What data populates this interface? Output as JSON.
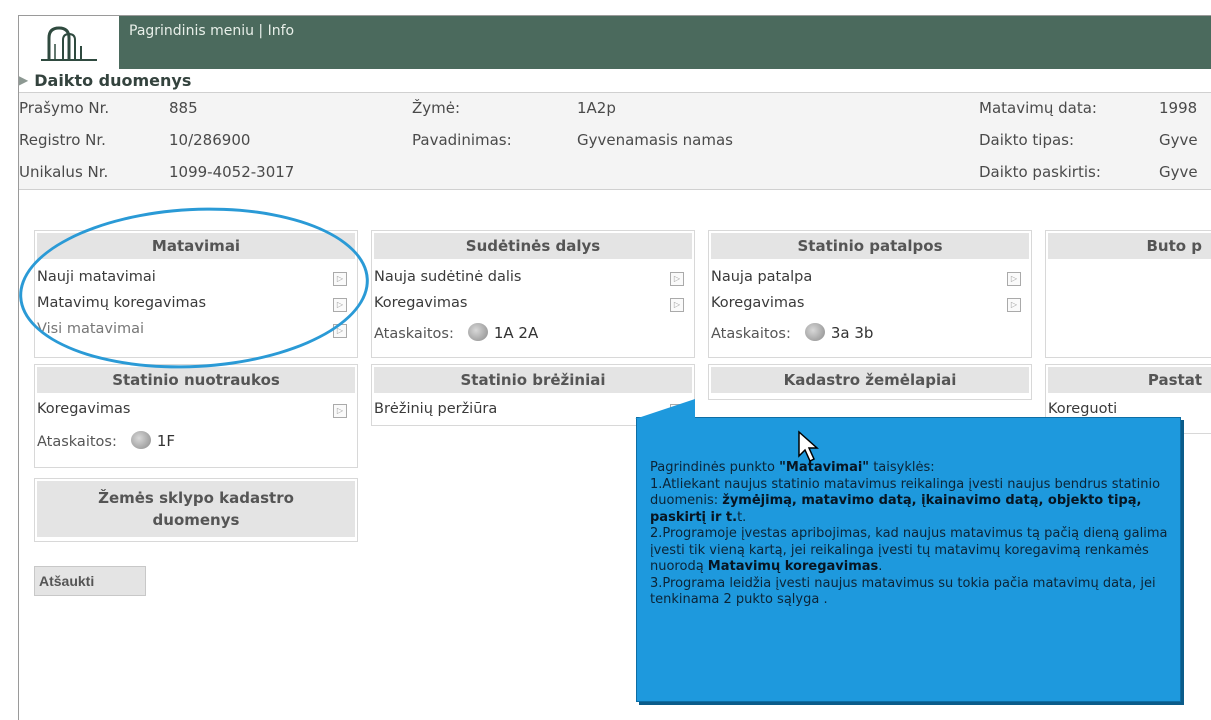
{
  "header": {
    "menu_main": "Pagrindinis meniu",
    "menu_sep": "|",
    "menu_info": "Info"
  },
  "section": {
    "title": "Daikto duomenys"
  },
  "info": {
    "request_no_label": "Prašymo Nr.",
    "request_no": "885",
    "registry_no_label": "Registro Nr.",
    "registry_no": "10/286900",
    "unique_no_label": "Unikalus Nr.",
    "unique_no": "1099-4052-3017",
    "mark_label": "Žymė:",
    "mark": "1A2p",
    "name_label": "Pavadinimas:",
    "name": "Gyvenamasis namas",
    "measure_date_label": "Matavimų data:",
    "measure_date": "1998",
    "type_label": "Daikto tipas:",
    "type": "Gyve",
    "purpose_label": "Daikto paskirtis:",
    "purpose": "Gyve"
  },
  "panels": {
    "matavimai": {
      "title": "Matavimai",
      "items": [
        "Nauji matavimai",
        "Matavimų koregavimas",
        "Visi matavimai"
      ]
    },
    "sudetines": {
      "title": "Sudėtinės dalys",
      "items": [
        "Nauja sudėtinė dalis",
        "Koregavimas"
      ],
      "reports_label": "Ataskaitos:",
      "reports": "1A 2A"
    },
    "patalpos": {
      "title": "Statinio patalpos",
      "items": [
        "Nauja patalpa",
        "Koregavimas"
      ],
      "reports_label": "Ataskaitos:",
      "reports": "3a 3b"
    },
    "buto": {
      "title": "Buto p"
    },
    "nuotraukos": {
      "title": "Statinio nuotraukos",
      "items": [
        "Koregavimas"
      ],
      "reports_label": "Ataskaitos:",
      "reports": "1F"
    },
    "breziniai": {
      "title": "Statinio brėžiniai",
      "items": [
        "Brėžinių peržiūra"
      ]
    },
    "kadastro": {
      "title": "Kadastro žemėlapiai"
    },
    "pastat": {
      "title": "Pastat",
      "items": [
        "Koreguoti"
      ]
    },
    "zemes": {
      "title_line1": "Žemės sklypo kadastro",
      "title_line2": "duomenys"
    }
  },
  "cancel_label": "Atšaukti",
  "tooltip": {
    "line1_a": "Pagrindinės punkto ",
    "line1_b": "\"Matavimai\"",
    "line1_c": " taisyklės:",
    "p1_a": "1.Atliekant naujus statinio matavimus reikalinga įvesti naujus bendrus statinio duomenis: ",
    "p1_b": "žymėjimą, matavimo datą, įkainavimo datą, objekto tipą, paskirtį ir t.",
    "p1_c": "t.",
    "p2_a": "2.Programoje įvestas apribojimas, kad naujus matavimus tą pačią dieną galima įvesti tik vieną kartą, jei reikalinga įvesti tų matavimų koregavimą renkamės nuorodą ",
    "p2_b": "Matavimų koregavimas",
    "p2_c": ".",
    "p3": "3.Programa leidžia įvesti naujus matavimus su tokia pačia matavimų data, jei tenkinama 2 pukto sąlyga ."
  }
}
